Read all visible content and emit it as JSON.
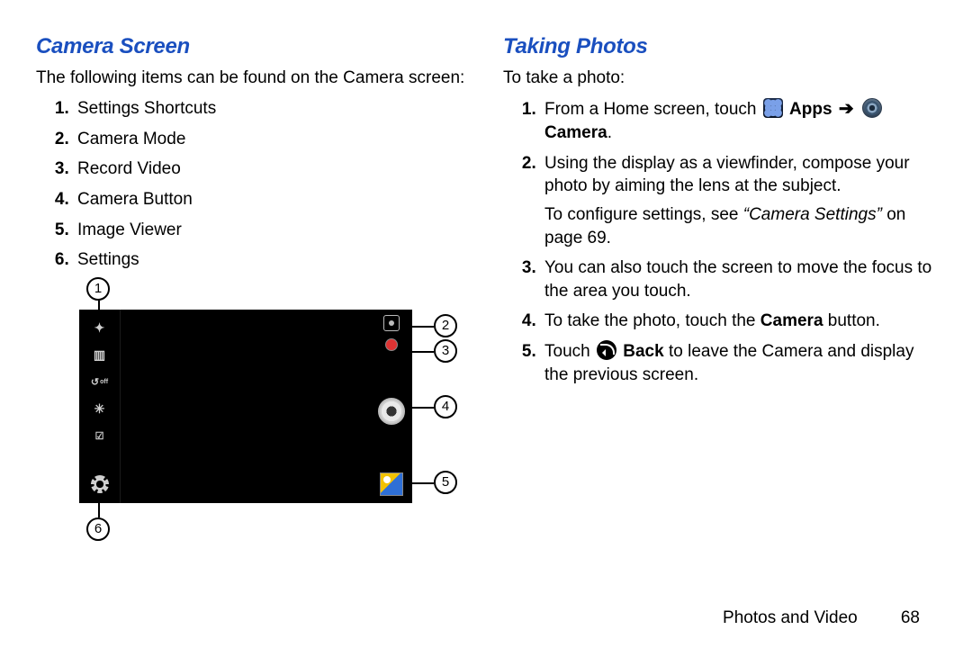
{
  "left": {
    "heading": "Camera Screen",
    "intro": "The following items can be found on the Camera screen:",
    "items": [
      "Settings Shortcuts",
      "Camera Mode",
      "Record Video",
      "Camera Button",
      "Image Viewer",
      "Settings"
    ],
    "callouts": [
      "1",
      "2",
      "3",
      "4",
      "5",
      "6"
    ]
  },
  "right": {
    "heading": "Taking Photos",
    "intro": "To take a photo:",
    "step1_a": "From a Home screen, touch ",
    "step1_apps": "Apps",
    "step1_camera": "Camera",
    "step1_dot": ".",
    "step2": "Using the display as a viewfinder, compose your photo by aiming the lens at the subject.",
    "step2_sub_a": "To configure settings, see ",
    "step2_sub_quote": "“Camera Settings”",
    "step2_sub_b": " on page 69.",
    "step3": "You can also touch the screen to move the focus to the area you touch.",
    "step4_a": "To take the photo, touch the ",
    "step4_b": "Camera",
    "step4_c": " button.",
    "step5_a": "Touch ",
    "step5_back": "Back",
    "step5_b": " to leave the Camera and display the previous screen."
  },
  "footer": {
    "section": "Photos and Video",
    "page": "68"
  }
}
